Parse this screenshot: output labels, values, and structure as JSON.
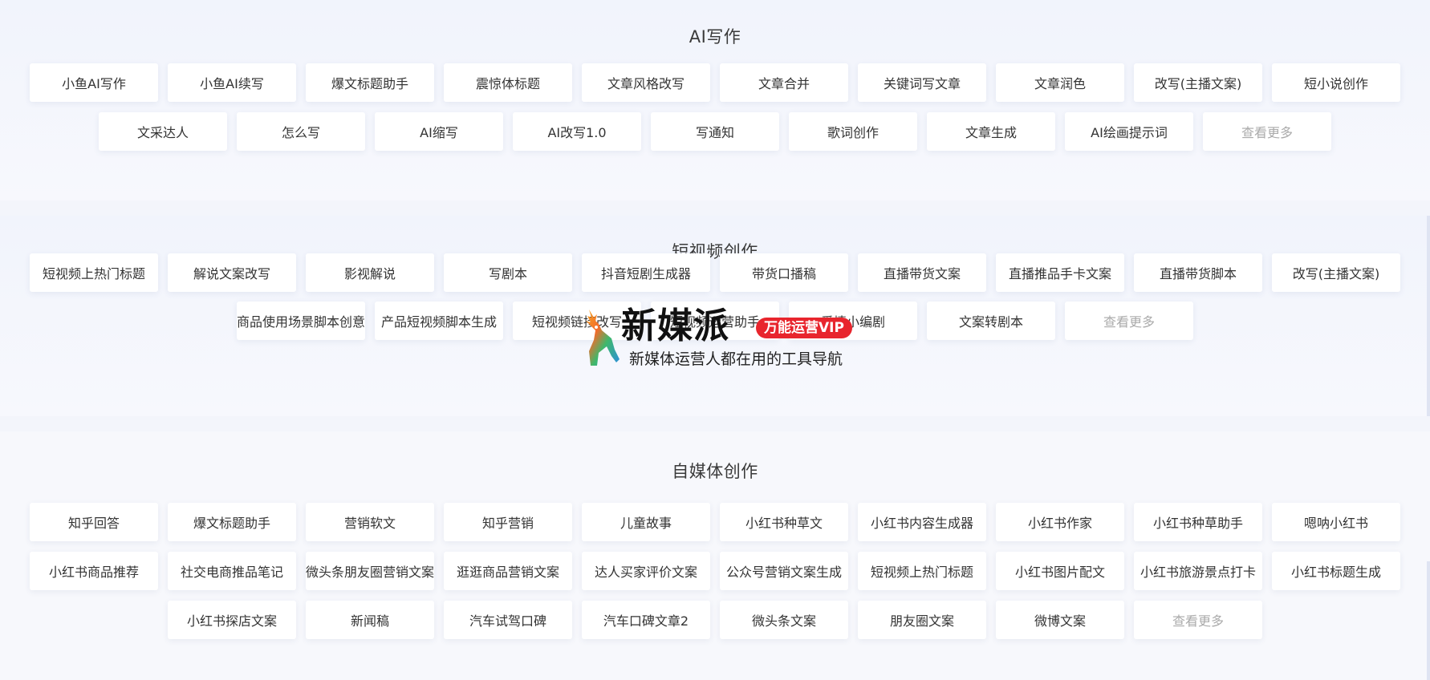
{
  "sections": {
    "ai_writing": {
      "title": "AI写作",
      "row1": [
        "小鱼AI写作",
        "小鱼AI续写",
        "爆文标题助手",
        "震惊体标题",
        "文章风格改写",
        "文章合并",
        "关键词写文章",
        "文章润色",
        "改写(主播文案)",
        "短小说创作"
      ],
      "row2": [
        "文采达人",
        "怎么写",
        "AI缩写",
        "AI改写1.0",
        "写通知",
        "歌词创作",
        "文章生成",
        "AI绘画提示词"
      ],
      "more_label": "查看更多"
    },
    "short_video": {
      "title": "短视频创作",
      "row1": [
        "短视频上热门标题",
        "解说文案改写",
        "影视解说",
        "写剧本",
        "抖音短剧生成器",
        "带货口播稿",
        "直播带货文案",
        "直播推品手卡文案",
        "直播带货脚本",
        "改写(主播文案)"
      ],
      "row2": [
        "商品使用场景脚本创意",
        "产品短视频脚本生成",
        "短视频链接改写",
        "短视频运营助手",
        "爱情小编剧",
        "文案转剧本"
      ],
      "more_label": "查看更多"
    },
    "self_media": {
      "title": "自媒体创作",
      "row1": [
        "知乎回答",
        "爆文标题助手",
        "营销软文",
        "知乎营销",
        "儿童故事",
        "小红书种草文",
        "小红书内容生成器",
        "小红书作家",
        "小红书种草助手",
        "嗯呐小红书"
      ],
      "row2": [
        "小红书商品推荐",
        "社交电商推品笔记",
        "微头条朋友圈营销文案",
        "逛逛商品营销文案",
        "达人买家评价文案",
        "公众号营销文案生成",
        "短视频上热门标题",
        "小红书图片配文",
        "小红书旅游景点打卡",
        "小红书标题生成"
      ],
      "row3": [
        "小红书探店文案",
        "新闻稿",
        "汽车试驾口碑",
        "汽车口碑文章2",
        "微头条文案",
        "朋友圈文案",
        "微博文案"
      ],
      "more_label": "查看更多"
    }
  },
  "watermark": {
    "brand": "新媒派",
    "badge": "万能运营VIP",
    "slogan": "新媒体运营人都在用的工具导航"
  },
  "colors": {
    "page_bg": "#f3f5fb",
    "button_bg": "#ffffff",
    "more_text": "#aaaaaa",
    "badge_red": "#e8252d"
  }
}
